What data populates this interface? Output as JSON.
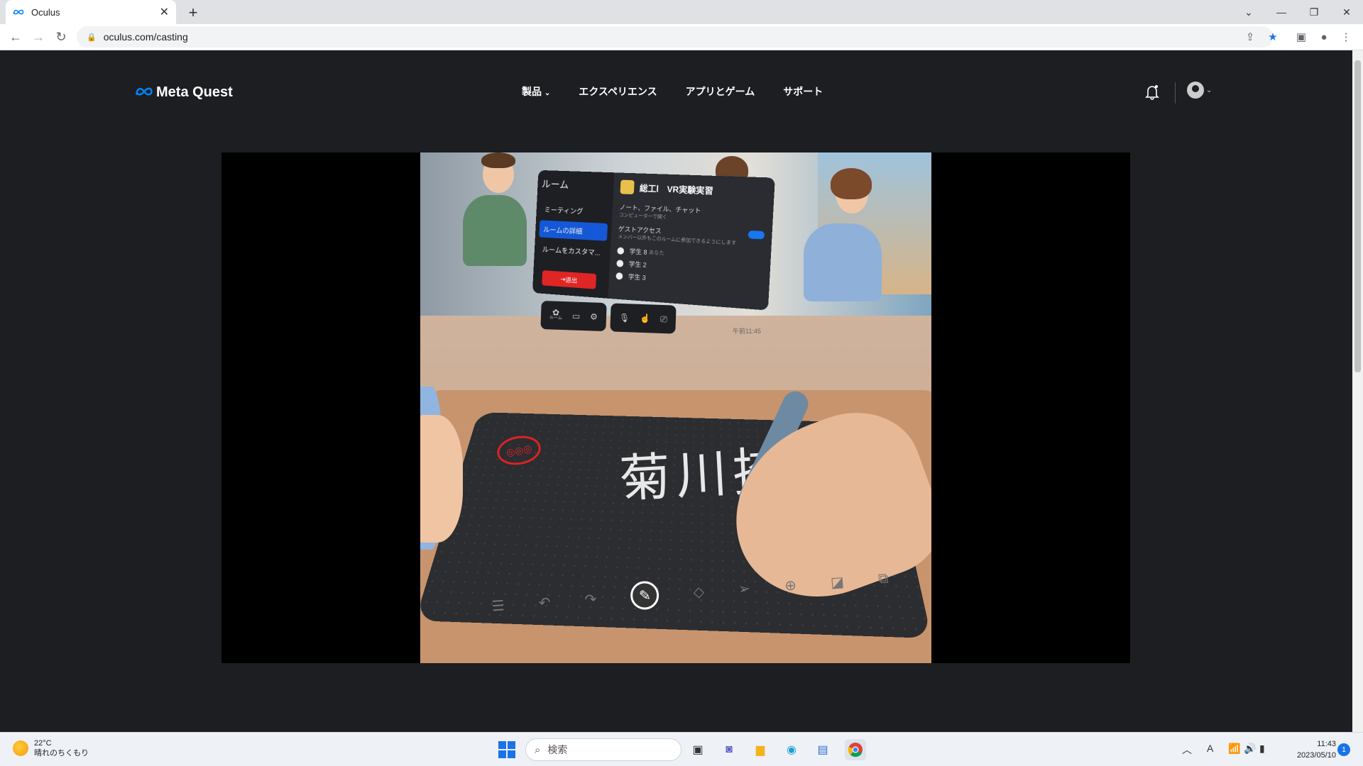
{
  "browser": {
    "tab_title": "Oculus",
    "new_tab": "+",
    "url": "oculus.com/casting",
    "window_controls": [
      "⌄",
      "—",
      "❐",
      "✕"
    ]
  },
  "site": {
    "logo_text": "Meta Quest",
    "nav": [
      {
        "label": "製品",
        "has_dropdown": true
      },
      {
        "label": "エクスペリエンス"
      },
      {
        "label": "アプリとゲーム"
      },
      {
        "label": "サポート"
      }
    ],
    "icons": [
      "bell-icon",
      "account-icon"
    ]
  },
  "vr": {
    "panel": {
      "title": "ルーム",
      "menu": [
        "ミーティング",
        "ルームの詳細",
        "ルームをカスタマ..."
      ],
      "selected_index": 1,
      "exit_label": "退出",
      "room_name": "総工Ⅰ　VR実験実習",
      "rows": [
        {
          "label": "ノート、ファイル、チャット",
          "sub": "コンピューターで開く"
        },
        {
          "label": "ゲストアクセス",
          "sub": "メンバー以外もこのルームに参加できるようにします"
        }
      ],
      "users": [
        {
          "name": "学生 8",
          "sub": "あなた"
        },
        {
          "name": "学生 2",
          "sub": ""
        },
        {
          "name": "学生 3",
          "sub": ""
        }
      ]
    },
    "bar_room_label": "ルーム",
    "time": "午前11:45",
    "handwriting": "菊川捺"
  },
  "taskbar": {
    "weather_temp": "22°C",
    "weather_desc": "晴れのちくもり",
    "search_placeholder": "検索",
    "time": "11:43",
    "date": "2023/05/10",
    "notifications": "1",
    "ime": "A"
  },
  "colors": {
    "page_bg": "#1c1e21",
    "meta_blue": "#0082fb",
    "chrome_star": "#1a73e8"
  }
}
